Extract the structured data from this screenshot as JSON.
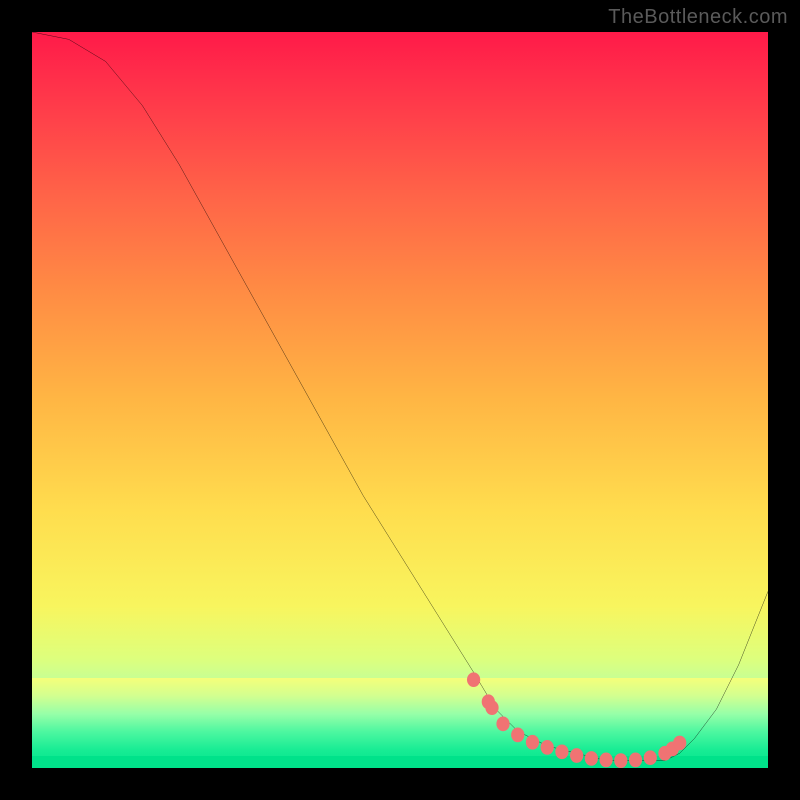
{
  "watermark": "TheBottleneck.com",
  "chart_data": {
    "type": "line",
    "title": "",
    "xlabel": "",
    "ylabel": "",
    "xlim": [
      0,
      100
    ],
    "ylim": [
      0,
      100
    ],
    "grid": false,
    "legend": false,
    "series": [
      {
        "name": "bottleneck-curve",
        "x": [
          0,
          5,
          10,
          15,
          20,
          25,
          30,
          35,
          40,
          45,
          50,
          55,
          60,
          63,
          66,
          70,
          74,
          78,
          82,
          86,
          88,
          90,
          93,
          96,
          100
        ],
        "y": [
          100,
          99,
          96,
          90,
          82,
          73,
          64,
          55,
          46,
          37,
          29,
          21,
          13,
          8,
          5,
          3,
          2,
          1,
          1,
          1,
          2,
          4,
          8,
          14,
          24
        ]
      }
    ],
    "markers": {
      "name": "highlight-dots",
      "x": [
        60,
        62,
        62.5,
        64,
        66,
        68,
        70,
        72,
        74,
        76,
        78,
        80,
        82,
        84,
        86,
        87,
        88
      ],
      "y": [
        12,
        9,
        8.2,
        6,
        4.5,
        3.5,
        2.8,
        2.2,
        1.7,
        1.3,
        1.1,
        1.0,
        1.1,
        1.4,
        2.0,
        2.6,
        3.4
      ]
    },
    "gradient_stops": [
      {
        "pos": 0,
        "color": "#ff1a49"
      },
      {
        "pos": 10,
        "color": "#ff3b4a"
      },
      {
        "pos": 22,
        "color": "#ff6348"
      },
      {
        "pos": 35,
        "color": "#ff8b44"
      },
      {
        "pos": 50,
        "color": "#ffb644"
      },
      {
        "pos": 65,
        "color": "#ffdd4e"
      },
      {
        "pos": 78,
        "color": "#f8f55e"
      },
      {
        "pos": 85,
        "color": "#deff7c"
      },
      {
        "pos": 90,
        "color": "#b8ffa4"
      },
      {
        "pos": 94,
        "color": "#5cffb2"
      },
      {
        "pos": 100,
        "color": "#00e98e"
      }
    ],
    "colors": {
      "curve": "#000000",
      "marker": "#f07373",
      "frame": "#000000"
    }
  }
}
